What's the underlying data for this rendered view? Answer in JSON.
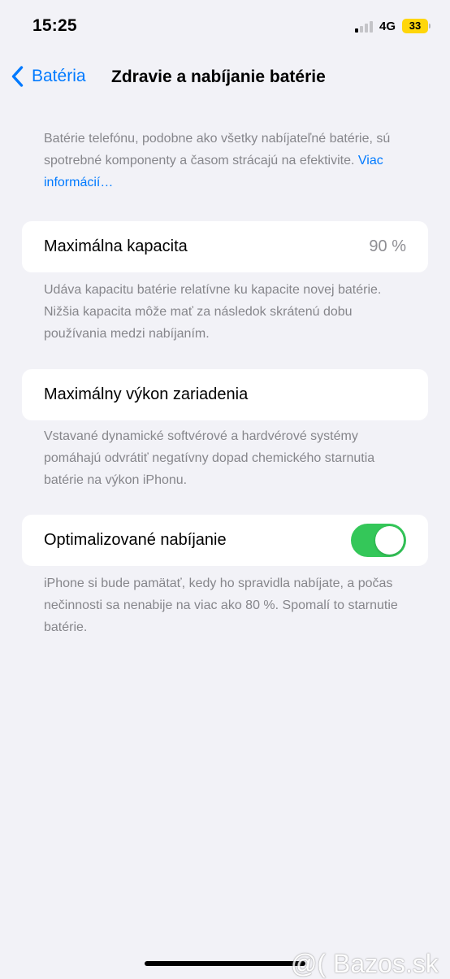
{
  "status_bar": {
    "time": "15:25",
    "network": "4G",
    "battery_level": "33",
    "signal_bars": 1,
    "battery_color": "#ffd60a",
    "signal_icon": "cellular-signal-icon"
  },
  "nav": {
    "back_label": "Batéria",
    "title": "Zdravie a nabíjanie batérie",
    "back_icon": "chevron-left-icon",
    "accent_color": "#007aff"
  },
  "intro": {
    "text": "Batérie telefónu, podobne ako všetky nabíjateľné batérie, sú spotrebné komponenty a časom strácajú na efektivite.",
    "link": "Viac informácií…"
  },
  "max_capacity": {
    "label": "Maximálna kapacita",
    "value": "90 %",
    "footnote": "Udáva kapacitu batérie relatívne ku kapacite novej batérie. Nižšia kapacita môže mať za následok skrátenú dobu používania medzi nabíjaním."
  },
  "peak_performance": {
    "label": "Maximálny výkon zariadenia",
    "footnote": "Vstavané dynamické softvérové a hardvérové systémy pomáhajú odvrátiť negatívny dopad chemického starnutia batérie na výkon iPhonu."
  },
  "optimized_charging": {
    "label": "Optimalizované nabíjanie",
    "enabled": true,
    "toggle_color": "#34c759",
    "footnote": "iPhone si bude pamätať, kedy ho spravidla nabíjate, a počas nečinnosti sa nenabije na viac ako 80 %. Spomalí to starnutie batérie."
  },
  "watermark": "@( Bazos.sk"
}
